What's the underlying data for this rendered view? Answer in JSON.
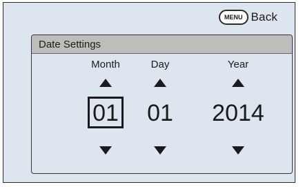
{
  "header": {
    "menu_button_label": "MENU",
    "back_label": "Back"
  },
  "panel": {
    "title": "Date Settings"
  },
  "fields": {
    "month": {
      "label": "Month",
      "value": "01",
      "selected": true
    },
    "day": {
      "label": "Day",
      "value": "01",
      "selected": false
    },
    "year": {
      "label": "Year",
      "value": "2014",
      "selected": false
    }
  },
  "icons": {
    "increment": "triangle-up-icon",
    "decrement": "triangle-down-icon"
  },
  "colors": {
    "background": "#dde6ef",
    "header_bar": "#bdbdbd",
    "text": "#1a1a1a"
  }
}
